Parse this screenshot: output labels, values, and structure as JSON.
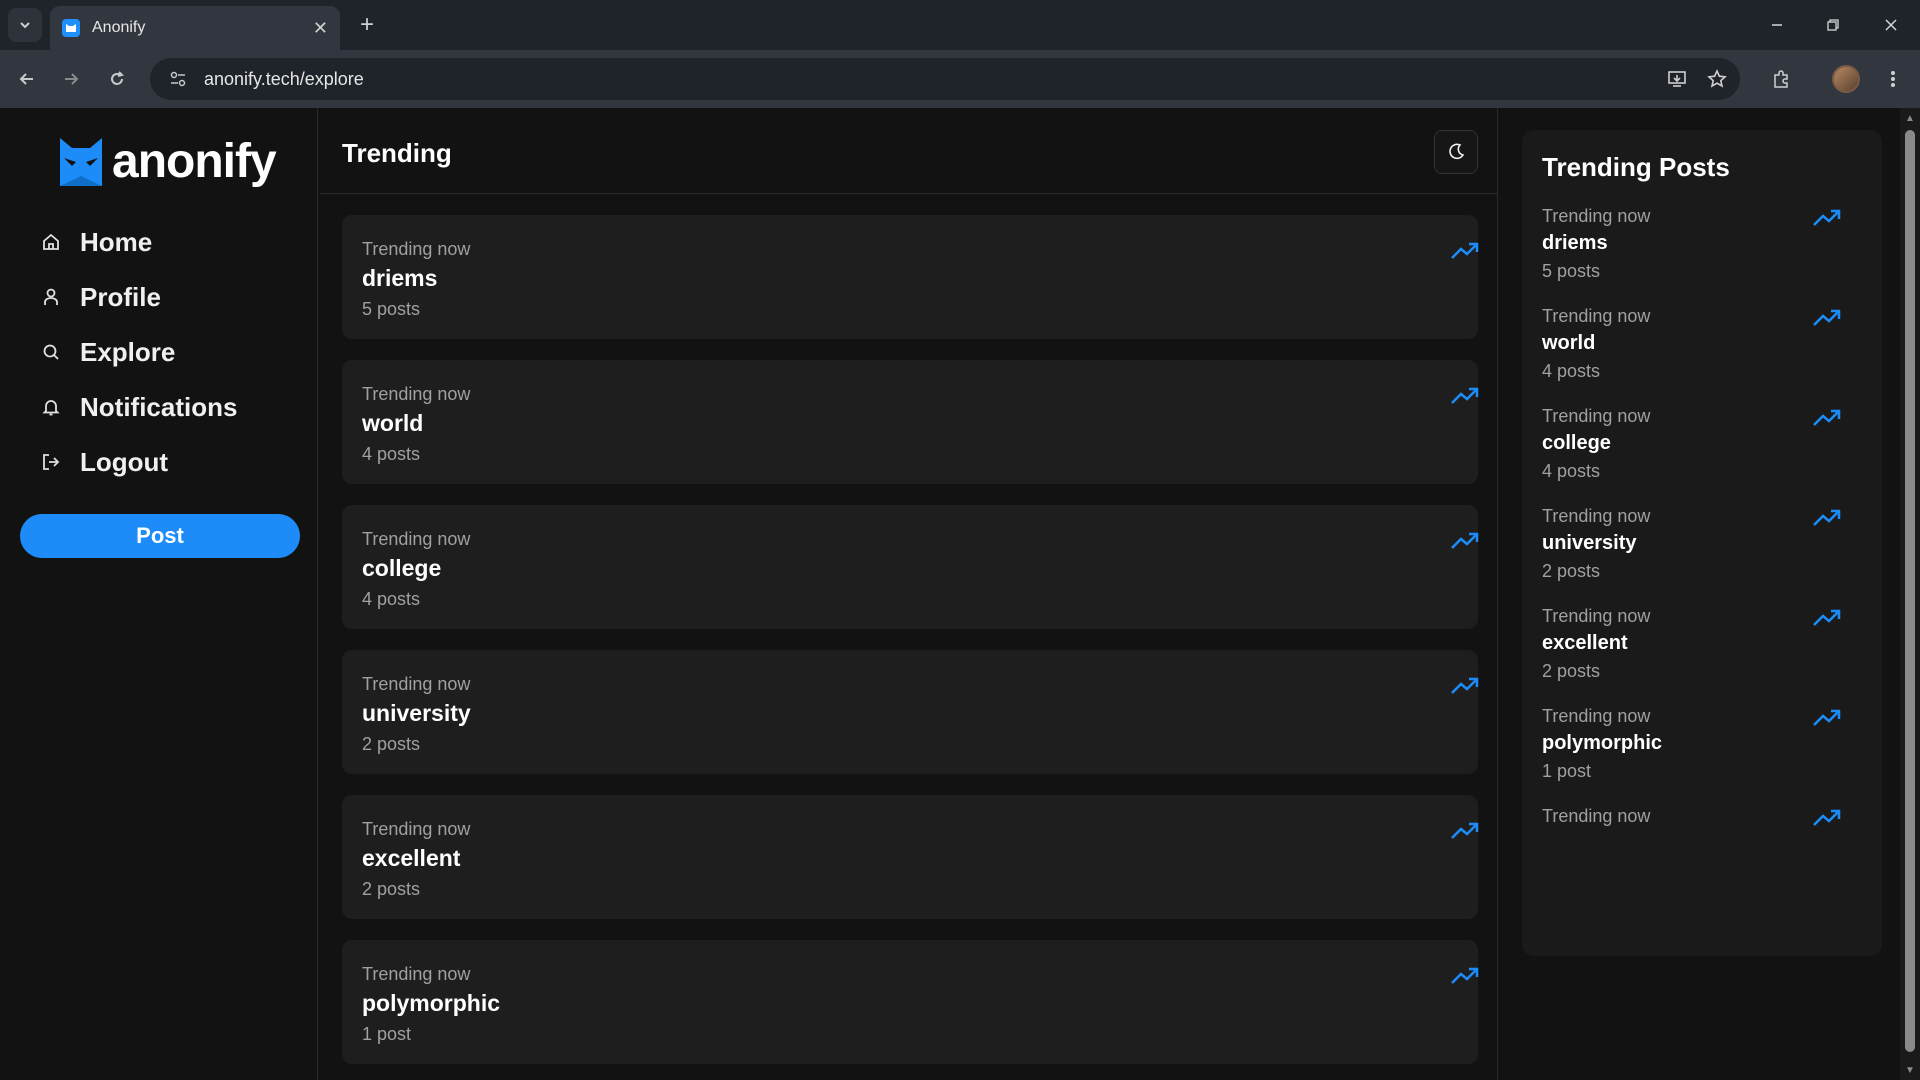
{
  "browser": {
    "tab_title": "Anonify",
    "url": "anonify.tech/explore"
  },
  "brand": {
    "name": "anonify",
    "accent": "#1d8cf8"
  },
  "nav": {
    "items": [
      {
        "label": "Home",
        "icon": "home-icon"
      },
      {
        "label": "Profile",
        "icon": "user-icon"
      },
      {
        "label": "Explore",
        "icon": "search-icon"
      },
      {
        "label": "Notifications",
        "icon": "bell-icon"
      },
      {
        "label": "Logout",
        "icon": "logout-icon"
      }
    ],
    "post_label": "Post"
  },
  "main": {
    "title": "Trending",
    "cards": [
      {
        "meta": "Trending now",
        "topic": "driems",
        "count": "5 posts"
      },
      {
        "meta": "Trending now",
        "topic": "world",
        "count": "4 posts"
      },
      {
        "meta": "Trending now",
        "topic": "college",
        "count": "4 posts"
      },
      {
        "meta": "Trending now",
        "topic": "university",
        "count": "2 posts"
      },
      {
        "meta": "Trending now",
        "topic": "excellent",
        "count": "2 posts"
      },
      {
        "meta": "Trending now",
        "topic": "polymorphic",
        "count": "1 post"
      }
    ]
  },
  "right": {
    "title": "Trending Posts",
    "items": [
      {
        "meta": "Trending now",
        "topic": "driems",
        "count": "5 posts"
      },
      {
        "meta": "Trending now",
        "topic": "world",
        "count": "4 posts"
      },
      {
        "meta": "Trending now",
        "topic": "college",
        "count": "4 posts"
      },
      {
        "meta": "Trending now",
        "topic": "university",
        "count": "2 posts"
      },
      {
        "meta": "Trending now",
        "topic": "excellent",
        "count": "2 posts"
      },
      {
        "meta": "Trending now",
        "topic": "polymorphic",
        "count": "1 post"
      },
      {
        "meta": "Trending now",
        "topic": "",
        "count": ""
      }
    ]
  }
}
